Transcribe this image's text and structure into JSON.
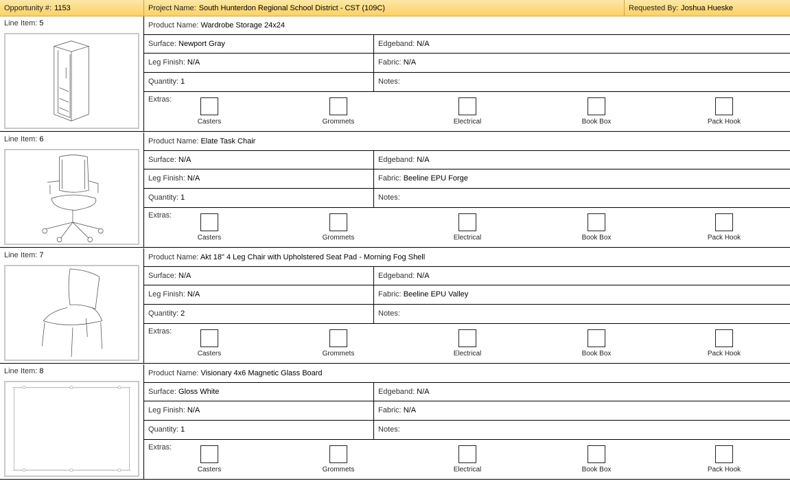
{
  "header": {
    "opportunity_label": "Opportunity #:",
    "opportunity_value": "1153",
    "project_label": "Project Name:",
    "project_value": "South Hunterdon Regional School District - CST (109C)",
    "requested_label": "Requested By:",
    "requested_value": "Joshua Hueske"
  },
  "labels": {
    "line_item": "Line Item:",
    "product_name": "Product Name:",
    "surface": "Surface:",
    "edgeband": "Edgeband:",
    "leg_finish": "Leg Finish:",
    "fabric": "Fabric:",
    "quantity": "Quantity:",
    "notes": "Notes:",
    "extras": "Extras:"
  },
  "extras_options": [
    "Casters",
    "Grommets",
    "Electrical",
    "Book Box",
    "Pack Hook"
  ],
  "items": [
    {
      "line_item": "5",
      "image": "wardrobe-storage-image",
      "product_name": "Wardrobe Storage 24x24",
      "surface": "Newport Gray",
      "edgeband": "N/A",
      "leg_finish": "N/A",
      "fabric": "N/A",
      "quantity": "1",
      "notes": ""
    },
    {
      "line_item": "6",
      "image": "task-chair-image",
      "product_name": "Elate Task Chair",
      "surface": "N/A",
      "edgeband": "N/A",
      "leg_finish": "N/A",
      "fabric": "Beeline EPU Forge",
      "quantity": "1",
      "notes": ""
    },
    {
      "line_item": "7",
      "image": "four-leg-chair-image",
      "product_name": "Akt 18\" 4 Leg Chair with Upholstered Seat Pad - Morning Fog Shell",
      "surface": "N/A",
      "edgeband": "N/A",
      "leg_finish": "N/A",
      "fabric": "Beeline EPU Valley",
      "quantity": "2",
      "notes": ""
    },
    {
      "line_item": "8",
      "image": "glass-board-image",
      "product_name": "Visionary 4x6 Magnetic Glass Board",
      "surface": "Gloss White",
      "edgeband": "N/A",
      "leg_finish": "N/A",
      "fabric": "N/A",
      "quantity": "1",
      "notes": ""
    }
  ]
}
